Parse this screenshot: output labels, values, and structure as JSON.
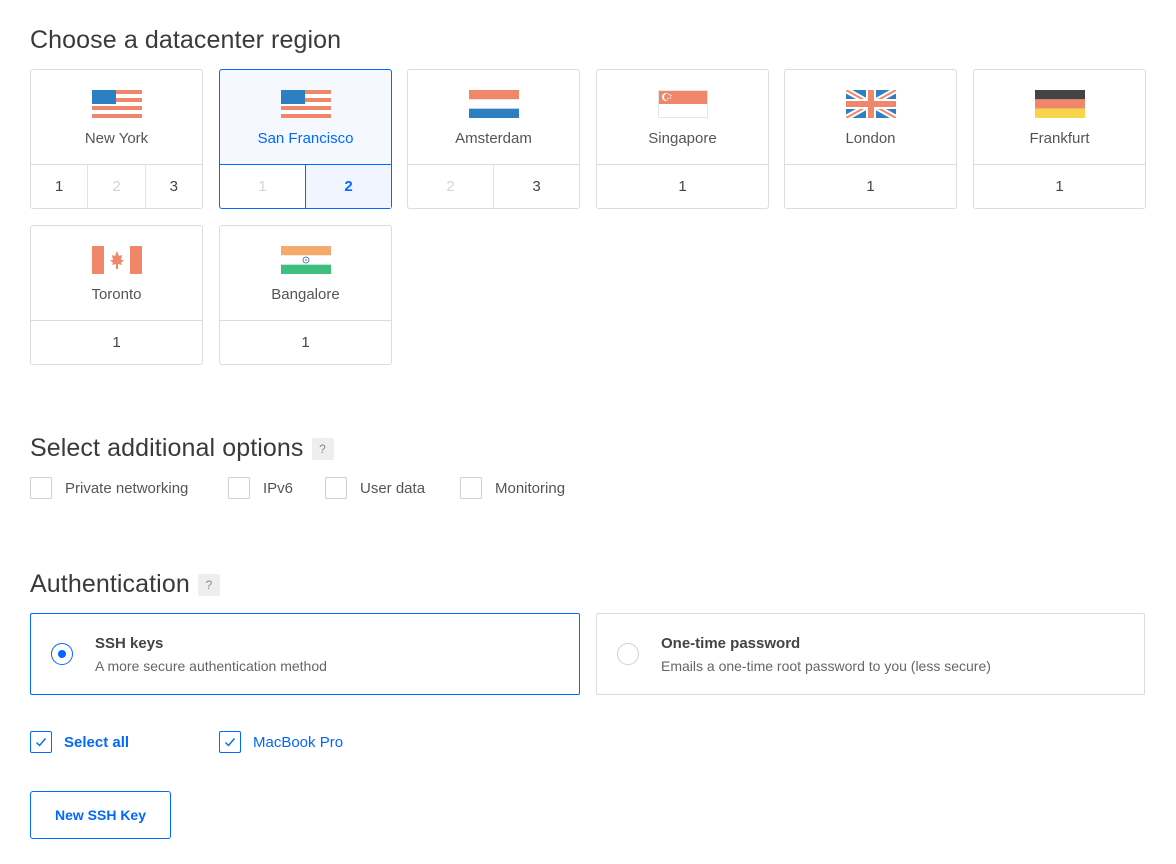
{
  "region_section": {
    "title": "Choose a datacenter region",
    "regions": [
      {
        "name": "New York",
        "flag": "us-flag",
        "options": [
          {
            "label": "1",
            "state": "normal"
          },
          {
            "label": "2",
            "state": "disabled"
          },
          {
            "label": "3",
            "state": "normal"
          }
        ],
        "selected": false
      },
      {
        "name": "San Francisco",
        "flag": "us-flag",
        "options": [
          {
            "label": "1",
            "state": "disabled"
          },
          {
            "label": "2",
            "state": "active"
          }
        ],
        "selected": true
      },
      {
        "name": "Amsterdam",
        "flag": "nl-flag",
        "options": [
          {
            "label": "2",
            "state": "disabled"
          },
          {
            "label": "3",
            "state": "normal"
          }
        ],
        "selected": false
      },
      {
        "name": "Singapore",
        "flag": "sg-flag",
        "options": [
          {
            "label": "1",
            "state": "normal"
          }
        ],
        "selected": false
      },
      {
        "name": "London",
        "flag": "uk-flag",
        "options": [
          {
            "label": "1",
            "state": "normal"
          }
        ],
        "selected": false
      },
      {
        "name": "Frankfurt",
        "flag": "de-flag",
        "options": [
          {
            "label": "1",
            "state": "normal"
          }
        ],
        "selected": false
      },
      {
        "name": "Toronto",
        "flag": "ca-flag",
        "options": [
          {
            "label": "1",
            "state": "normal"
          }
        ],
        "selected": false
      },
      {
        "name": "Bangalore",
        "flag": "in-flag",
        "options": [
          {
            "label": "1",
            "state": "normal"
          }
        ],
        "selected": false
      }
    ]
  },
  "options_section": {
    "title": "Select additional options",
    "help": "?",
    "options": [
      {
        "label": "Private networking",
        "checked": false
      },
      {
        "label": "IPv6",
        "checked": false
      },
      {
        "label": "User data",
        "checked": false
      },
      {
        "label": "Monitoring",
        "checked": false
      }
    ]
  },
  "auth_section": {
    "title": "Authentication",
    "help": "?",
    "methods": [
      {
        "title": "SSH keys",
        "description": "A more secure authentication method",
        "selected": true
      },
      {
        "title": "One-time password",
        "description": "Emails a one-time root password to you (less secure)",
        "selected": false
      }
    ],
    "keys": [
      {
        "label": "Select all",
        "checked": true
      },
      {
        "label": "MacBook Pro",
        "checked": true
      }
    ],
    "new_key_button": "New SSH Key"
  },
  "colors": {
    "accent": "#0069ff",
    "border": "#dcdcdc"
  }
}
